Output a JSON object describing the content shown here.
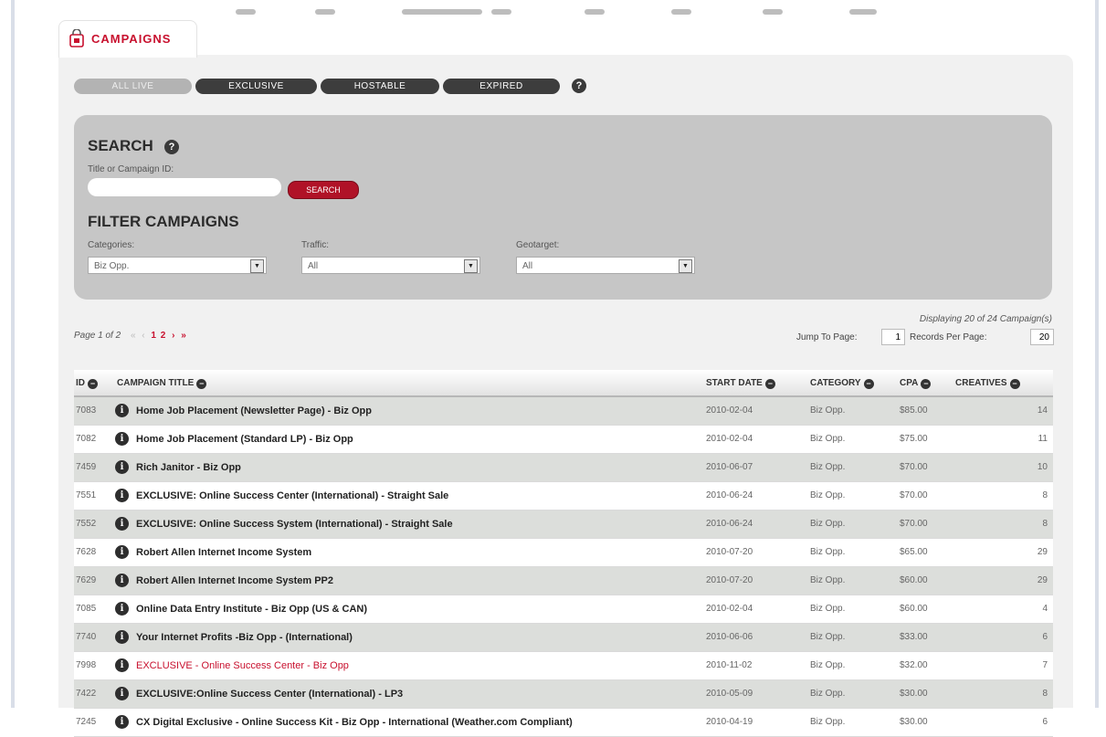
{
  "tab": {
    "title": "CAMPAIGNS",
    "icon": "shopping-bag-icon"
  },
  "filters": {
    "pills": [
      "ALL LIVE",
      "EXCLUSIVE",
      "HOSTABLE",
      "EXPIRED"
    ],
    "help": "?"
  },
  "search": {
    "heading": "SEARCH",
    "field_label": "Title or Campaign ID:",
    "input_value": "",
    "button": "SEARCH"
  },
  "filter_campaigns": {
    "heading": "FILTER CAMPAIGNS",
    "categories_label": "Categories:",
    "categories_value": "Biz Opp.",
    "traffic_label": "Traffic:",
    "traffic_value": "All",
    "geotarget_label": "Geotarget:",
    "geotarget_value": "All",
    "arrow": "▼"
  },
  "pagination": {
    "page_text": "Page 1 of 2",
    "first": "«",
    "prev": "‹",
    "page1": "1",
    "page2": "2",
    "next": "›",
    "last": "»",
    "display_text": "Displaying 20 of 24 Campaign(s)",
    "jump_label": "Jump To Page:",
    "jump_value": "1",
    "records_label": "Records Per Page:",
    "records_value": "20"
  },
  "table": {
    "headers": {
      "id": "ID",
      "title": "CAMPAIGN TITLE",
      "start": "START DATE",
      "category": "CATEGORY",
      "cpa": "CPA",
      "creatives": "CREATIVES"
    },
    "sort_icon": "−",
    "info_icon": "i",
    "rows": [
      {
        "id": "7083",
        "title": "Home Job Placement (Newsletter Page) - Biz Opp",
        "date": "2010-02-04",
        "category": "Biz Opp.",
        "cpa": "$85.00",
        "creatives": "14"
      },
      {
        "id": "7082",
        "title": "Home Job Placement (Standard LP) - Biz Opp",
        "date": "2010-02-04",
        "category": "Biz Opp.",
        "cpa": "$75.00",
        "creatives": "11"
      },
      {
        "id": "7459",
        "title": "Rich Janitor - Biz Opp",
        "date": "2010-06-07",
        "category": "Biz Opp.",
        "cpa": "$70.00",
        "creatives": "10"
      },
      {
        "id": "7551",
        "title": "EXCLUSIVE: Online Success Center (International) - Straight Sale",
        "date": "2010-06-24",
        "category": "Biz Opp.",
        "cpa": "$70.00",
        "creatives": "8"
      },
      {
        "id": "7552",
        "title": "EXCLUSIVE: Online Success System (International) - Straight Sale",
        "date": "2010-06-24",
        "category": "Biz Opp.",
        "cpa": "$70.00",
        "creatives": "8"
      },
      {
        "id": "7628",
        "title": "Robert Allen Internet Income System",
        "date": "2010-07-20",
        "category": "Biz Opp.",
        "cpa": "$65.00",
        "creatives": "29"
      },
      {
        "id": "7629",
        "title": "Robert Allen Internet Income System PP2",
        "date": "2010-07-20",
        "category": "Biz Opp.",
        "cpa": "$60.00",
        "creatives": "29"
      },
      {
        "id": "7085",
        "title": "Online Data Entry Institute - Biz Opp (US & CAN)",
        "date": "2010-02-04",
        "category": "Biz Opp.",
        "cpa": "$60.00",
        "creatives": "4"
      },
      {
        "id": "7740",
        "title": "Your Internet Profits -Biz Opp - (International)",
        "date": "2010-06-06",
        "category": "Biz Opp.",
        "cpa": "$33.00",
        "creatives": "6"
      },
      {
        "id": "7998",
        "title": "EXCLUSIVE - Online Success Center - Biz Opp",
        "date": "2010-11-02",
        "category": "Biz Opp.",
        "cpa": "$32.00",
        "creatives": "7"
      },
      {
        "id": "7422",
        "title": "EXCLUSIVE:Online Success Center (International) - LP3",
        "date": "2010-05-09",
        "category": "Biz Opp.",
        "cpa": "$30.00",
        "creatives": "8"
      },
      {
        "id": "7245",
        "title": "CX Digital Exclusive - Online Success Kit - Biz Opp - International (Weather.com Compliant)",
        "date": "2010-04-19",
        "category": "Biz Opp.",
        "cpa": "$30.00",
        "creatives": "6"
      }
    ]
  }
}
